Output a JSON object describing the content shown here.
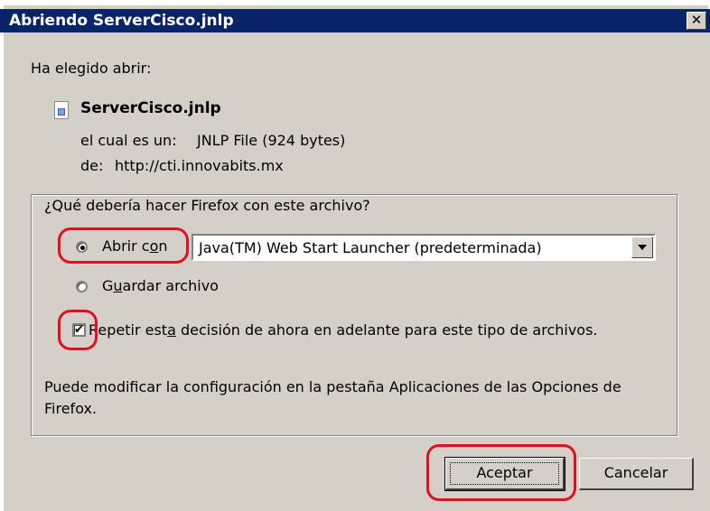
{
  "window": {
    "title": "Abriendo ServerCisco.jnlp",
    "close_glyph": "✕"
  },
  "intro_label": "Ha elegido abrir:",
  "file": {
    "icon": "jnlp-file-icon",
    "name": "ServerCisco.jnlp",
    "type_label": "el cual es un:",
    "type_value": "JNLP File (924 bytes)",
    "from_label": "de:",
    "from_value": "http://cti.innovabits.mx"
  },
  "action_group": {
    "legend": "¿Qué debería hacer Firefox con este archivo?",
    "open_with": {
      "label_pre": "Abrir c",
      "label_mnemonic": "o",
      "label_post": "n",
      "selected": true
    },
    "app_select": {
      "value": "Java(TM) Web Start Launcher (predeterminada)"
    },
    "save_file": {
      "label_pre": "G",
      "label_mnemonic": "u",
      "label_post": "ardar archivo",
      "selected": false
    },
    "remember": {
      "label_pre": "Repetir est",
      "label_mnemonic": "a",
      "label_post": " decisión de ahora en adelante para este tipo de archivos.",
      "checked": true
    },
    "note_line1": "Puede modificar la configuración en la pestaña Aplicaciones de las Opciones de",
    "note_line2": "Firefox."
  },
  "buttons": {
    "ok": "Aceptar",
    "cancel": "Cancelar"
  },
  "colors": {
    "titlebar": "#0a246a",
    "dialog_bg": "#d4d0c8",
    "annotation": "#e01020"
  }
}
